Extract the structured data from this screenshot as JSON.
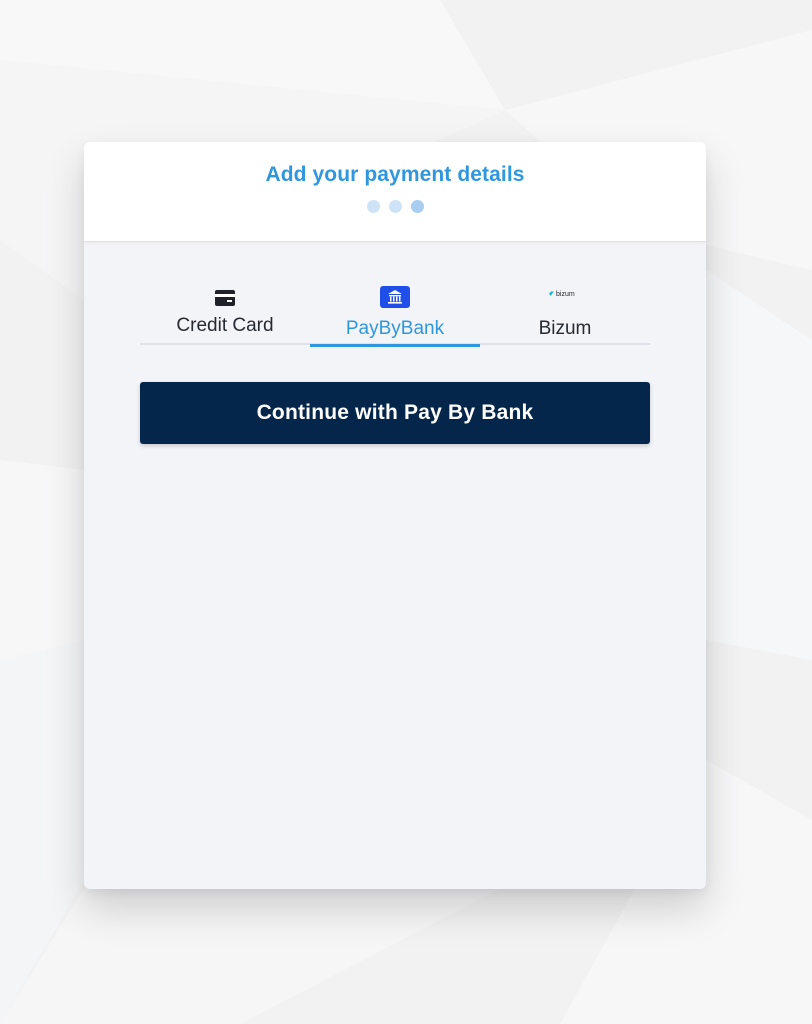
{
  "header": {
    "title": "Add your payment details",
    "steps": [
      {
        "state": "done"
      },
      {
        "state": "done"
      },
      {
        "state": "current"
      }
    ]
  },
  "tabs": [
    {
      "label": "Credit Card",
      "icon": "credit-card-icon",
      "active": false
    },
    {
      "label": "PayByBank",
      "icon": "bank-icon",
      "active": true
    },
    {
      "label": "Bizum",
      "icon": "bizum-logo-icon",
      "logo_text": "bizum",
      "active": false
    }
  ],
  "action": {
    "continue_label": "Continue with Pay By Bank"
  },
  "colors": {
    "accent": "#2f97de",
    "button_bg": "#04264a",
    "bank_icon_bg": "#1f4fe8",
    "card_bg": "#f3f4f8"
  }
}
